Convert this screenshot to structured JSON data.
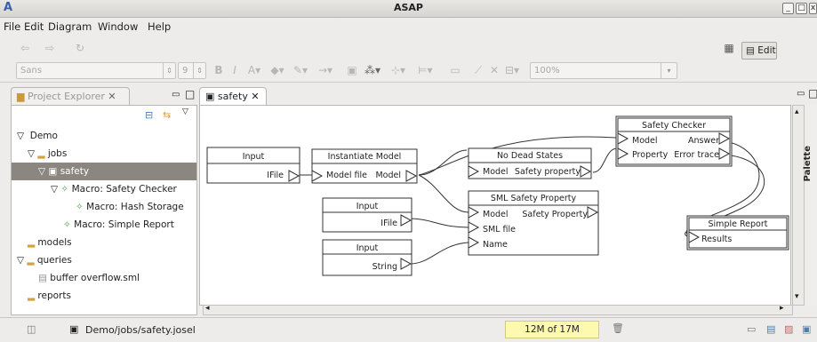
{
  "window": {
    "app_letter": "A",
    "title": "ASAP"
  },
  "menu": [
    {
      "label": "File"
    },
    {
      "label": "Edit"
    },
    {
      "label": "Diagram"
    },
    {
      "label": "Window"
    },
    {
      "label": "Help"
    }
  ],
  "toolbar": {
    "font_combo": "Sans",
    "size_combo": "9",
    "zoom_combo": "100%",
    "edit_label": "Edit"
  },
  "project_explorer": {
    "tab_label": "Project Explorer",
    "tree": [
      {
        "label": "Demo"
      },
      {
        "label": "jobs"
      },
      {
        "label": "safety"
      },
      {
        "label": "Macro: Safety Checker"
      },
      {
        "label": "Macro: Hash Storage"
      },
      {
        "label": "Macro: Simple Report"
      },
      {
        "label": "models"
      },
      {
        "label": "queries"
      },
      {
        "label": "buffer overflow.sml"
      },
      {
        "label": "reports"
      }
    ]
  },
  "editor": {
    "tab_label": "safety"
  },
  "diagram": {
    "input1": {
      "title": "Input",
      "port": "IFile"
    },
    "instantiate": {
      "title": "Instantiate Model",
      "in": "Model file",
      "out": "Model"
    },
    "no_dead": {
      "title": "No Dead States",
      "in": "Model",
      "out": "Safety property"
    },
    "sml": {
      "title": "SML Safety Property",
      "in1": "Model",
      "out": "Safety Property",
      "in2": "SML file",
      "in3": "Name"
    },
    "input2": {
      "title": "Input",
      "port": "IFile"
    },
    "input3": {
      "title": "Input",
      "port": "String"
    },
    "checker": {
      "title": "Safety Checker",
      "in1": "Model",
      "out1": "Answer",
      "in2": "Property",
      "out2": "Error trace"
    },
    "report": {
      "title": "Simple Report",
      "in": "Results"
    }
  },
  "palette": {
    "label": "Palette"
  },
  "status": {
    "path": "Demo/jobs/safety.josel",
    "memory": "12M of 17M"
  }
}
